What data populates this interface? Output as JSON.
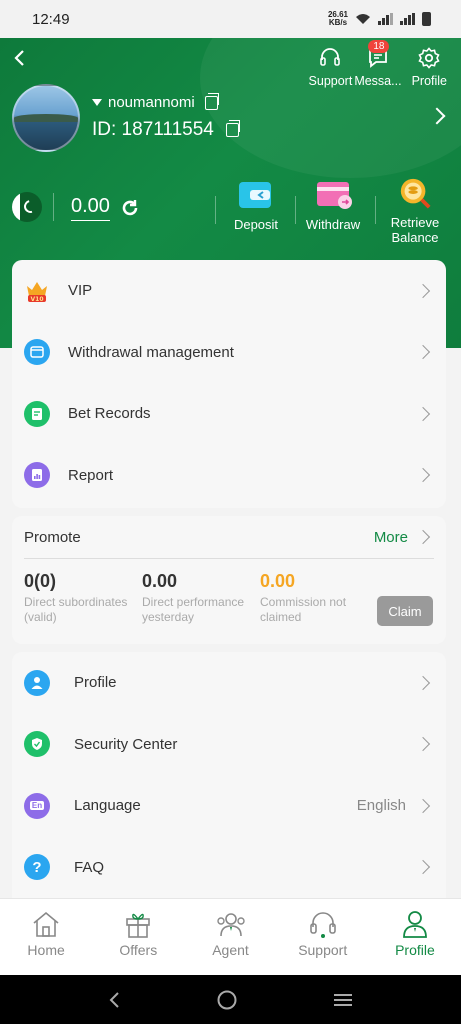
{
  "status_bar": {
    "time": "12:49",
    "net_speed": "26.61",
    "net_unit": "KB/s"
  },
  "header": {
    "top_actions": [
      {
        "label": "Support",
        "icon": "headset-icon"
      },
      {
        "label": "Messa...",
        "icon": "message-icon",
        "badge": "18"
      },
      {
        "label": "Profile",
        "icon": "gear-icon"
      }
    ],
    "username": "noumannomi",
    "user_id": "ID: 187111554",
    "balance": "0.00",
    "actions": [
      {
        "label": "Deposit",
        "icon": "deposit-icon"
      },
      {
        "label": "Withdraw",
        "icon": "withdraw-icon"
      },
      {
        "label_line1": "Retrieve",
        "label_line2": "Balance",
        "icon": "retrieve-balance-icon"
      }
    ]
  },
  "menu1": [
    {
      "label": "VIP",
      "icon": "vip-crown-icon",
      "icon_text": "V10"
    },
    {
      "label": "Withdrawal management",
      "icon": "wallet-icon"
    },
    {
      "label": "Bet Records",
      "icon": "document-icon"
    },
    {
      "label": "Report",
      "icon": "report-icon"
    }
  ],
  "promote": {
    "title": "Promote",
    "more": "More",
    "stats": [
      {
        "value": "0(0)",
        "desc1": "Direct subordinates",
        "desc2": "(valid)"
      },
      {
        "value": "0.00",
        "desc1": "Direct performance",
        "desc2": "yesterday"
      },
      {
        "value": "0.00",
        "desc1": "Commission not",
        "desc2": "claimed"
      }
    ],
    "claim": "Claim"
  },
  "menu2": [
    {
      "label": "Profile",
      "icon": "person-icon"
    },
    {
      "label": "Security Center",
      "icon": "shield-icon"
    },
    {
      "label": "Language",
      "icon": "language-icon",
      "icon_text": "En",
      "value": "English"
    },
    {
      "label": "FAQ",
      "icon": "question-icon",
      "icon_text": "?"
    }
  ],
  "bottom_nav": [
    {
      "label": "Home",
      "icon": "home-icon"
    },
    {
      "label": "Offers",
      "icon": "gift-icon"
    },
    {
      "label": "Agent",
      "icon": "agent-icon"
    },
    {
      "label": "Support",
      "icon": "headset-icon"
    },
    {
      "label": "Profile",
      "icon": "person-icon",
      "active": true
    }
  ],
  "colors": {
    "brand_green": "#138a45",
    "badge_red": "#f0443b",
    "commission_orange": "#f5a623"
  }
}
